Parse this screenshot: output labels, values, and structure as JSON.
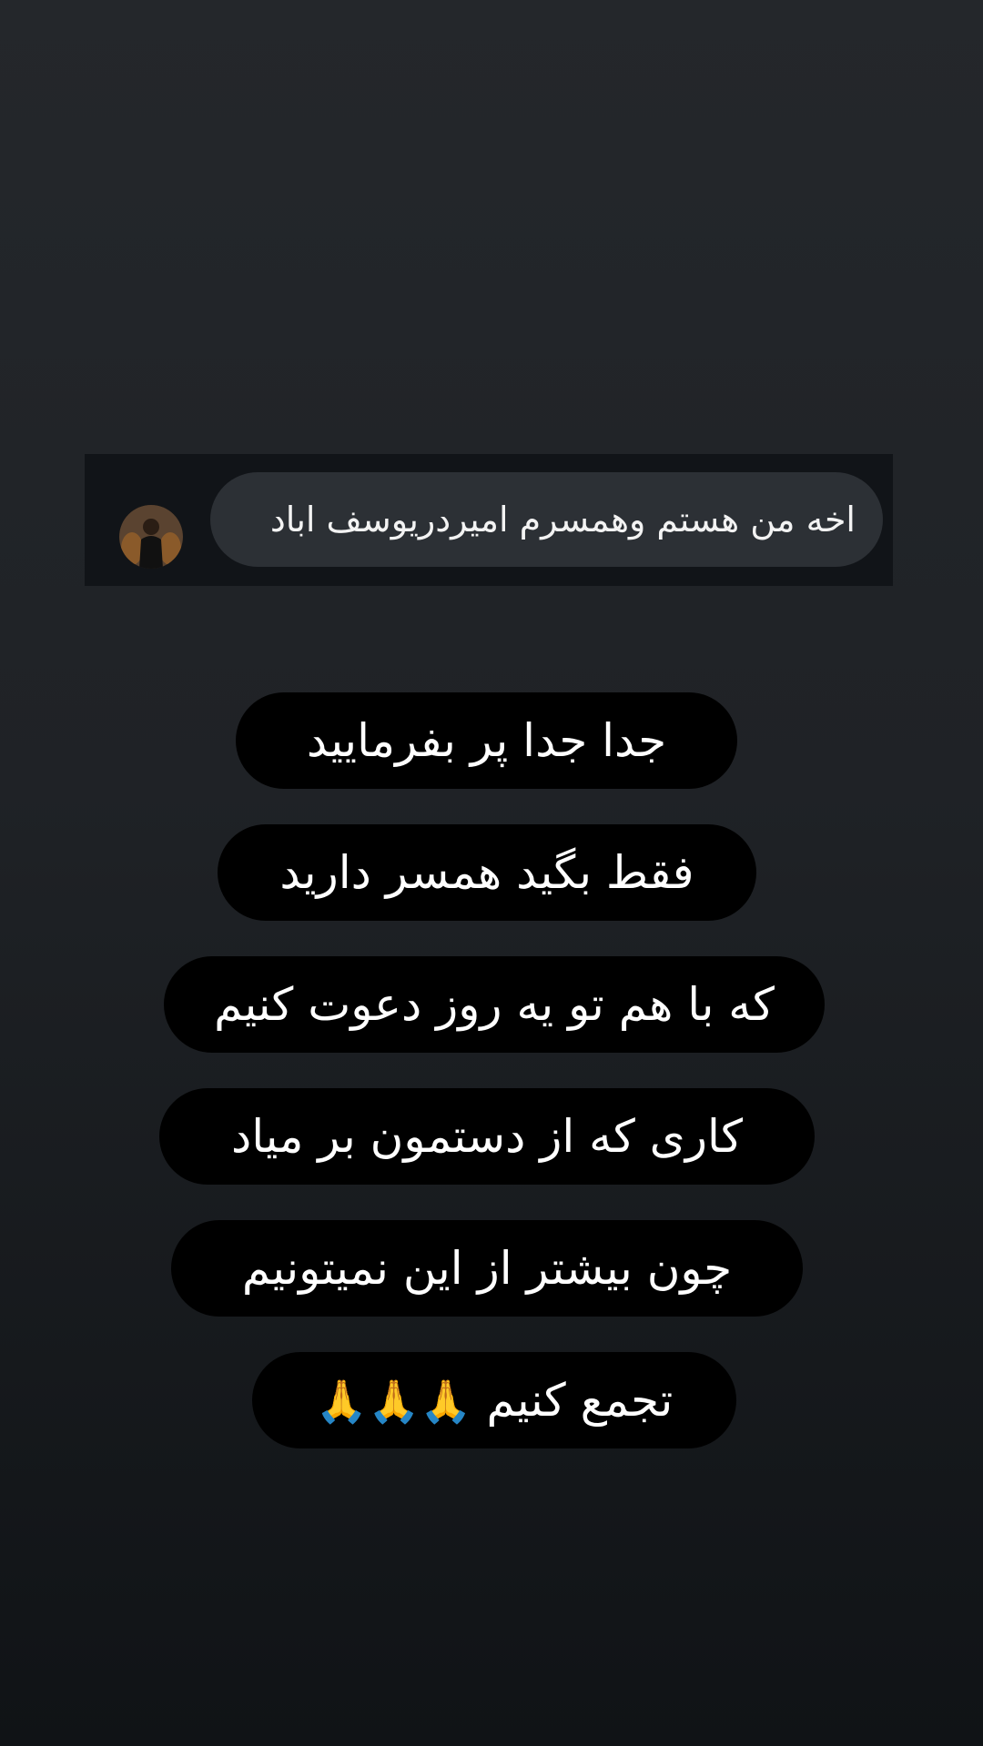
{
  "reply": {
    "avatar_icon": "user-avatar-photo-icon",
    "text": "اخه من هستم وهمسرم امیردریوسف اباد"
  },
  "story_lines": [
    {
      "text": "جدا جدا پر بفرمایید"
    },
    {
      "text": "فقط بگید همسر دارید"
    },
    {
      "text": "که با هم تو یه روز دعوت کنیم"
    },
    {
      "text": "کاری که از دستمون بر میاد"
    },
    {
      "text": "چون بیشتر از این نمیتونیم"
    },
    {
      "text": "تجمع کنیم",
      "emoji": "🙏🙏🙏",
      "emoji_icon": "folded-hands-icon"
    }
  ],
  "colors": {
    "background_top": "#24272b",
    "background_bottom": "#101316",
    "line_background": "#000000",
    "reply_bubble": "#2c3035",
    "reply_card": "#111418",
    "text": "#ffffff"
  }
}
